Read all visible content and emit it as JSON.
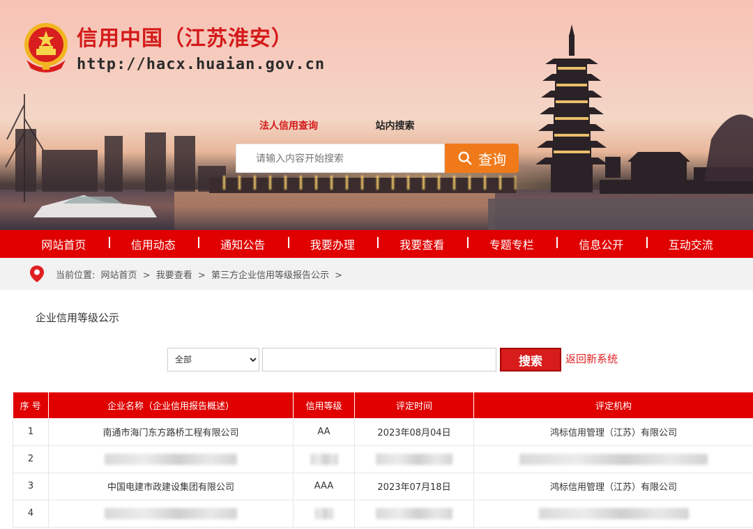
{
  "header": {
    "title": "信用中国（江苏淮安）",
    "url": "http://hacx.huaian.gov.cn"
  },
  "search": {
    "tab_active": "法人信用查询",
    "tab_other": "站内搜索",
    "placeholder": "请输入内容开始搜索",
    "button_label": "查询"
  },
  "nav": {
    "items": [
      {
        "label": "网站首页"
      },
      {
        "label": "信用动态"
      },
      {
        "label": "通知公告"
      },
      {
        "label": "我要办理"
      },
      {
        "label": "我要查看"
      },
      {
        "label": "专题专栏"
      },
      {
        "label": "信息公开"
      },
      {
        "label": "互动交流"
      }
    ]
  },
  "breadcrumb": {
    "prefix": "当前位置:",
    "items": [
      "网站首页",
      "我要查看",
      "第三方企业信用等级报告公示"
    ],
    "separator": ">"
  },
  "panel": {
    "tab_label": "企业信用等级公示"
  },
  "filter": {
    "selected": "全部",
    "input_value": "",
    "search_label": "搜索",
    "back_link": "返回新系统"
  },
  "table": {
    "headers": [
      "序 号",
      "企业名称（企业信用报告概述）",
      "信用等级",
      "评定时间",
      "评定机构"
    ],
    "rows": [
      {
        "no": "1",
        "name": "南通市海门东方路桥工程有限公司",
        "level": "AA",
        "date": "2023年08月04日",
        "org": "鸿标信用管理（江苏）有限公司",
        "blurred": false
      },
      {
        "no": "2",
        "name": "",
        "level": "",
        "date": "",
        "org": "",
        "blurred": true
      },
      {
        "no": "3",
        "name": "中国电建市政建设集团有限公司",
        "level": "AAA",
        "date": "2023年07月18日",
        "org": "鸿标信用管理（江苏）有限公司",
        "blurred": false
      },
      {
        "no": "4",
        "name": "",
        "level": "",
        "date": "",
        "org": "",
        "blurred": true
      }
    ]
  },
  "colors": {
    "brand_red": "#e00000",
    "accent_orange": "#f07a1a",
    "title_red": "#d41a1a"
  }
}
